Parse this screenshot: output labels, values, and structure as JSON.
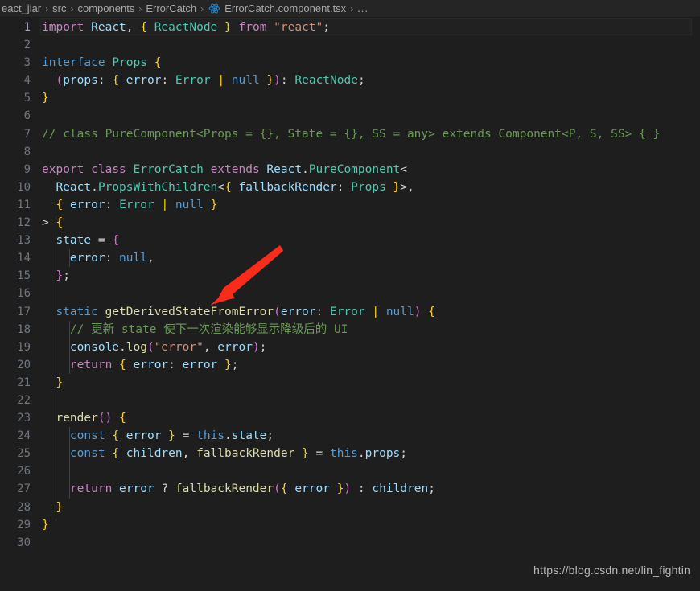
{
  "breadcrumb": {
    "separator": "›",
    "icon_name": "react-file-icon",
    "segments": [
      "eact_jiar",
      "src",
      "components",
      "ErrorCatch",
      "ErrorCatch.component.tsx"
    ],
    "ellipsis": "..."
  },
  "editor": {
    "active_line": 1,
    "total_lines": 30,
    "lines": [
      {
        "n": "1",
        "text": "import React, { ReactNode } from \"react\";"
      },
      {
        "n": "2",
        "text": ""
      },
      {
        "n": "3",
        "text": "interface Props {"
      },
      {
        "n": "4",
        "text": "  (props: { error: Error | null }): ReactNode;"
      },
      {
        "n": "5",
        "text": "}"
      },
      {
        "n": "6",
        "text": ""
      },
      {
        "n": "7",
        "text": "// class PureComponent<Props = {}, State = {}, SS = any> extends Component<P, S, SS> { }"
      },
      {
        "n": "8",
        "text": ""
      },
      {
        "n": "9",
        "text": "export class ErrorCatch extends React.PureComponent<"
      },
      {
        "n": "10",
        "text": "  React.PropsWithChildren<{ fallbackRender: Props }>,"
      },
      {
        "n": "11",
        "text": "  { error: Error | null }"
      },
      {
        "n": "12",
        "text": "> {"
      },
      {
        "n": "13",
        "text": "  state = {"
      },
      {
        "n": "14",
        "text": "    error: null,"
      },
      {
        "n": "15",
        "text": "  };"
      },
      {
        "n": "16",
        "text": ""
      },
      {
        "n": "17",
        "text": "  static getDerivedStateFromError(error: Error | null) {"
      },
      {
        "n": "18",
        "text": "    // 更新 state 使下一次渲染能够显示降级后的 UI"
      },
      {
        "n": "19",
        "text": "    console.log(\"error\", error);"
      },
      {
        "n": "20",
        "text": "    return { error: error };"
      },
      {
        "n": "21",
        "text": "  }"
      },
      {
        "n": "22",
        "text": ""
      },
      {
        "n": "23",
        "text": "  render() {"
      },
      {
        "n": "24",
        "text": "    const { error } = this.state;"
      },
      {
        "n": "25",
        "text": "    const { children, fallbackRender } = this.props;"
      },
      {
        "n": "26",
        "text": ""
      },
      {
        "n": "27",
        "text": "    return error ? fallbackRender({ error }) : children;"
      },
      {
        "n": "28",
        "text": "  }"
      },
      {
        "n": "29",
        "text": "}"
      },
      {
        "n": "30",
        "text": ""
      }
    ]
  },
  "annotation": {
    "arrow_name": "red-arrow-annotation",
    "color": "#f92c1c",
    "points_at_line": "17"
  },
  "watermark": {
    "text": "https://blog.csdn.net/lin_fightin"
  },
  "colors": {
    "background": "#1e1e1e",
    "breadcrumb_background": "#252526",
    "keyword": "#c586c0",
    "keyword_blue": "#569cd6",
    "variable": "#9cdcfe",
    "type": "#4ec9b0",
    "function": "#dcdcaa",
    "string": "#ce9178",
    "comment": "#6a9955",
    "brace": "#ffd700",
    "paren": "#da70d6",
    "line_number": "#6e7681",
    "arrow": "#f92c1c"
  }
}
